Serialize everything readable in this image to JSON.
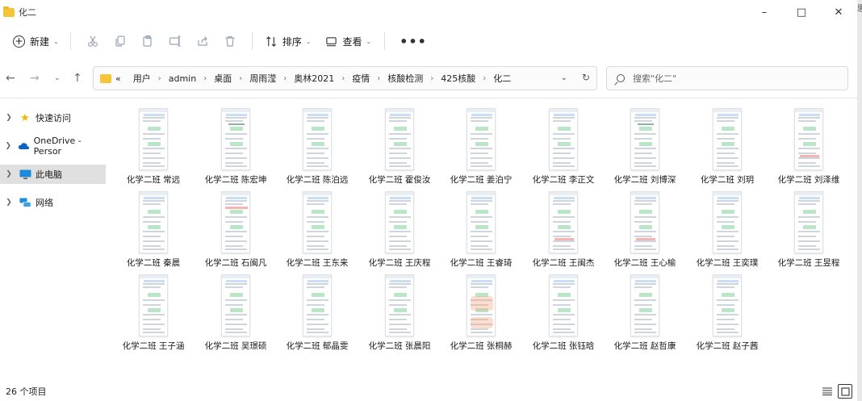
{
  "window": {
    "title": "化二"
  },
  "outer": {
    "edge_text": "思"
  },
  "toolbar": {
    "new_label": "新建",
    "sort_label": "排序",
    "view_label": "查看",
    "more_label": "•••",
    "icons": [
      "cut-icon",
      "copy-icon",
      "paste-icon",
      "rename-icon",
      "share-icon",
      "delete-icon"
    ]
  },
  "address": {
    "prefix": "«",
    "crumbs": [
      "用户",
      "admin",
      "桌面",
      "周雨滢",
      "奥林2021",
      "疫情",
      "核酸检测",
      "425核酸",
      "化二"
    ]
  },
  "search": {
    "placeholder": "搜索\"化二\""
  },
  "sidebar": {
    "items": [
      {
        "label": "快速访问",
        "icon": "star-icon",
        "color": "#f2b600"
      },
      {
        "label": "OneDrive - Persor",
        "icon": "cloud-icon",
        "color": "#0a64c8"
      },
      {
        "label": "此电脑",
        "icon": "monitor-icon",
        "color": "#1f8ad9",
        "selected": true
      },
      {
        "label": "网络",
        "icon": "network-icon",
        "color": "#1f8ad9"
      }
    ]
  },
  "files": [
    {
      "name": "化学二班 常远",
      "variant": "green"
    },
    {
      "name": "化学二班 陈宏坤",
      "variant": "form"
    },
    {
      "name": "化学二班 陈泊远",
      "variant": "green"
    },
    {
      "name": "化学二班 霍俊汝",
      "variant": "green"
    },
    {
      "name": "化学二班 姜泊宁",
      "variant": "green"
    },
    {
      "name": "化学二班 李正文",
      "variant": "green"
    },
    {
      "name": "化学二班 刘博深",
      "variant": "form"
    },
    {
      "name": "化学二班 刘玥",
      "variant": "green"
    },
    {
      "name": "化学二班 刘泽维",
      "variant": "red"
    },
    {
      "name": "化学二班 秦晨",
      "variant": "green"
    },
    {
      "name": "化学二班 石闽凡",
      "variant": "redhdr"
    },
    {
      "name": "化学二班 王东来",
      "variant": "green"
    },
    {
      "name": "化学二班 王庆程",
      "variant": "green"
    },
    {
      "name": "化学二班 王睿琦",
      "variant": "green"
    },
    {
      "name": "化学二班 王闽杰",
      "variant": "red"
    },
    {
      "name": "化学二班 王心榆",
      "variant": "red"
    },
    {
      "name": "化学二班 王奕璞",
      "variant": "green"
    },
    {
      "name": "化学二班 王昱程",
      "variant": "green"
    },
    {
      "name": "化学二班 王子涵",
      "variant": "green"
    },
    {
      "name": "化学二班 吴璟硕",
      "variant": "green"
    },
    {
      "name": "化学二班 郁晶雯",
      "variant": "green"
    },
    {
      "name": "化学二班 张晨阳",
      "variant": "green"
    },
    {
      "name": "化学二班 张桐赫",
      "variant": "handwritten"
    },
    {
      "name": "化学二班 张钰晗",
      "variant": "green"
    },
    {
      "name": "化学二班 赵哲康",
      "variant": "green"
    },
    {
      "name": "化学二班 赵子茜",
      "variant": "green"
    }
  ],
  "status": {
    "count": "26 个项目"
  }
}
